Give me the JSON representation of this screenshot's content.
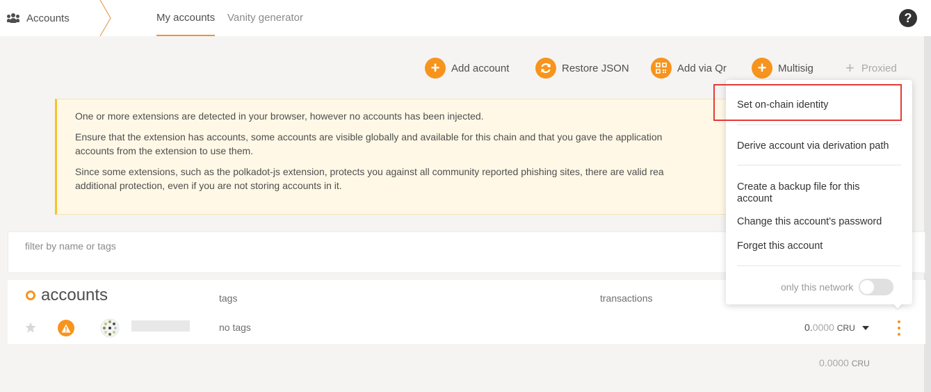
{
  "nav": {
    "section": "Accounts",
    "tabs": [
      {
        "label": "My accounts",
        "active": true
      },
      {
        "label": "Vanity generator",
        "active": false
      }
    ],
    "help": "?"
  },
  "actions": [
    {
      "label": "Add account",
      "icon": "plus-icon"
    },
    {
      "label": "Restore JSON",
      "icon": "sync-icon"
    },
    {
      "label": "Add via Qr",
      "icon": "qrcode-icon"
    },
    {
      "label": "Multisig",
      "icon": "plus-icon"
    },
    {
      "label": "Proxied",
      "icon": "plus-icon",
      "disabled": true
    }
  ],
  "warning": {
    "line1": "One or more extensions are detected in your browser, however no accounts has been injected.",
    "line2": "Ensure that the extension has accounts, some accounts are visible globally and available for this chain and that you gave the application",
    "line2b": "accounts from the extension to use them.",
    "line3": "Since some extensions, such as the polkadot-js extension, protects you against all community reported phishing sites, there are valid rea",
    "line3b": "additional protection, even if you are not storing accounts in it."
  },
  "filter": {
    "placeholder": "filter by name or tags"
  },
  "table": {
    "title": "accounts",
    "col_tags": "tags",
    "col_transactions": "transactions",
    "row": {
      "tags": "no tags",
      "balance_int": "0.",
      "balance_dec": "0000",
      "unit": "CRU"
    },
    "total": {
      "int": "0.",
      "dec": "0000",
      "unit": "CRU"
    }
  },
  "menu": {
    "items": [
      "Set on-chain identity",
      "Derive account via derivation path",
      "Create a backup file for this account",
      "Change this account's password",
      "Forget this account"
    ],
    "toggle_label": "only this network"
  },
  "colors": {
    "accent": "#f7941d",
    "highlight": "#e53935",
    "warning_bg": "#fff8e6"
  }
}
